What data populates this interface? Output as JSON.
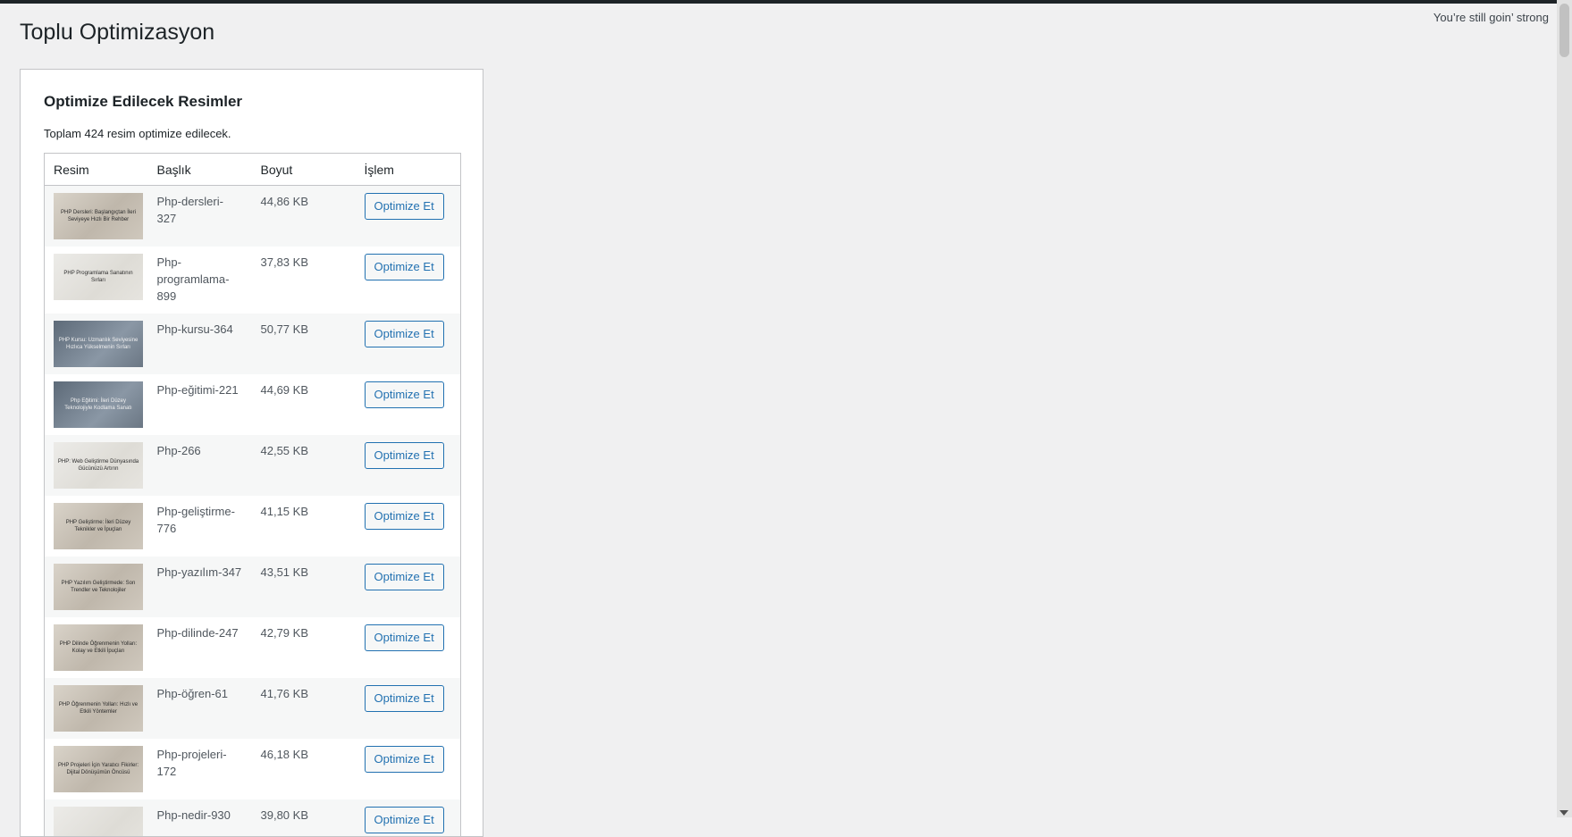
{
  "header": {
    "title": "Toplu Optimizasyon",
    "footer_note": "You’re still goin’ strong"
  },
  "card": {
    "heading": "Optimize Edilecek Resimler",
    "summary": "Toplam 424 resim optimize edilecek.",
    "columns": [
      "Resim",
      "Başlık",
      "Boyut",
      "İşlem"
    ],
    "action_label": "Optimize Et",
    "rows": [
      {
        "thumb_text": "PHP Dersleri: Başlangıçtan İleri Seviyeye Hızlı Bir Rehber",
        "title": "Php-dersleri-327",
        "size": "44,86 KB"
      },
      {
        "thumb_text": "PHP Programlama Sanatının Sırları",
        "title": "Php-programlama-899",
        "size": "37,83 KB"
      },
      {
        "thumb_text": "PHP Kursu: Uzmanlık Seviyesine Hızlıca Yükselmenin Sırları",
        "title": "Php-kursu-364",
        "size": "50,77 KB"
      },
      {
        "thumb_text": "Php Eğitimi: İleri Düzey Teknolojiyle Kodlama Sanatı",
        "title": "Php-eğitimi-221",
        "size": "44,69 KB"
      },
      {
        "thumb_text": "PHP: Web Geliştirme Dünyasında Gücünüzü Artırın",
        "title": "Php-266",
        "size": "42,55 KB"
      },
      {
        "thumb_text": "PHP Geliştirme: İleri Düzey Teknikler ve İpuçları",
        "title": "Php-geliştirme-776",
        "size": "41,15 KB"
      },
      {
        "thumb_text": "PHP Yazılım Geliştirmede: Son Trendler ve Teknolojiler",
        "title": "Php-yazılım-347",
        "size": "43,51 KB"
      },
      {
        "thumb_text": "PHP Dilinde Öğrenmenin Yolları: Kolay ve Etkili İpuçları",
        "title": "Php-dilinde-247",
        "size": "42,79 KB"
      },
      {
        "thumb_text": "PHP Öğrenmenin Yolları: Hızlı ve Etkili Yöntemler",
        "title": "Php-öğren-61",
        "size": "41,76 KB"
      },
      {
        "thumb_text": "PHP Projeleri İçin Yaratıcı Fikirler: Dijital Dönüşümün Öncüsü",
        "title": "Php-projeleri-172",
        "size": "46,18 KB"
      },
      {
        "thumb_text": "",
        "title": "Php-nedir-930",
        "size": "39,80 KB"
      }
    ]
  }
}
